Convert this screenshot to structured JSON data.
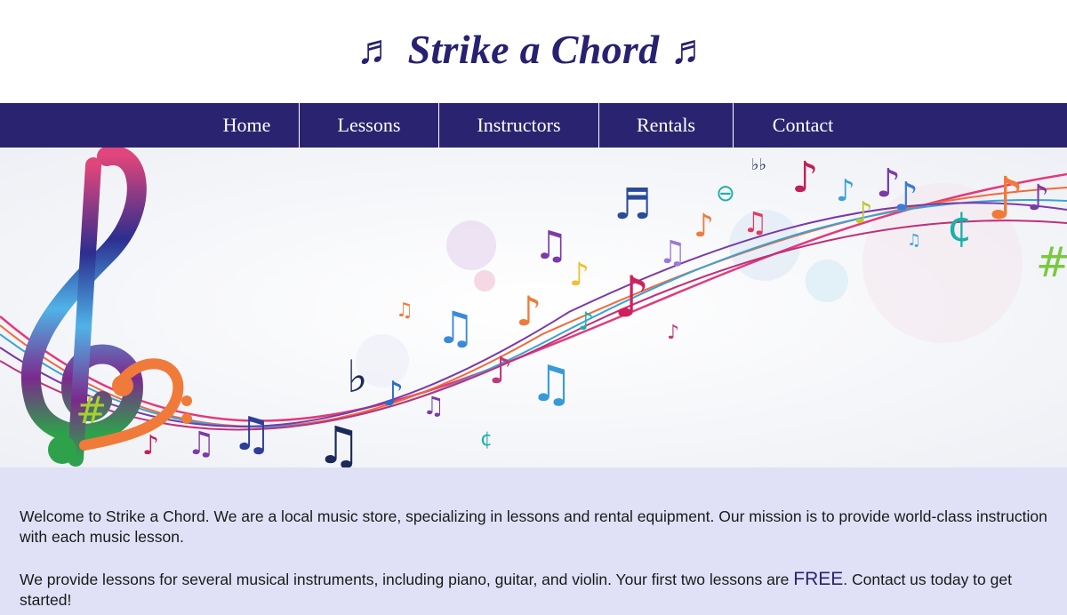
{
  "site": {
    "title": "Strike a Chord",
    "title_icon": "music-note-icon"
  },
  "nav": {
    "items": [
      {
        "label": "Home"
      },
      {
        "label": "Lessons"
      },
      {
        "label": "Instructors"
      },
      {
        "label": "Rentals"
      },
      {
        "label": "Contact"
      }
    ]
  },
  "hero": {
    "image": "colorful musical notes and staff lines banner"
  },
  "intro": {
    "p1": "Welcome to Strike a Chord. We are a local music store, specializing in lessons and rental equipment. Our mission is to provide world-class instruction with each music lesson.",
    "p2_before": "We provide lessons for several musical instruments, including piano, guitar, and violin. Your first two lessons are ",
    "p2_emphasis": "FREE",
    "p2_after": ". Contact us today to get started!"
  },
  "colors": {
    "brand": "#2a2470",
    "intro_bg": "#e0e1f7",
    "nav_text": "#ffffff"
  }
}
